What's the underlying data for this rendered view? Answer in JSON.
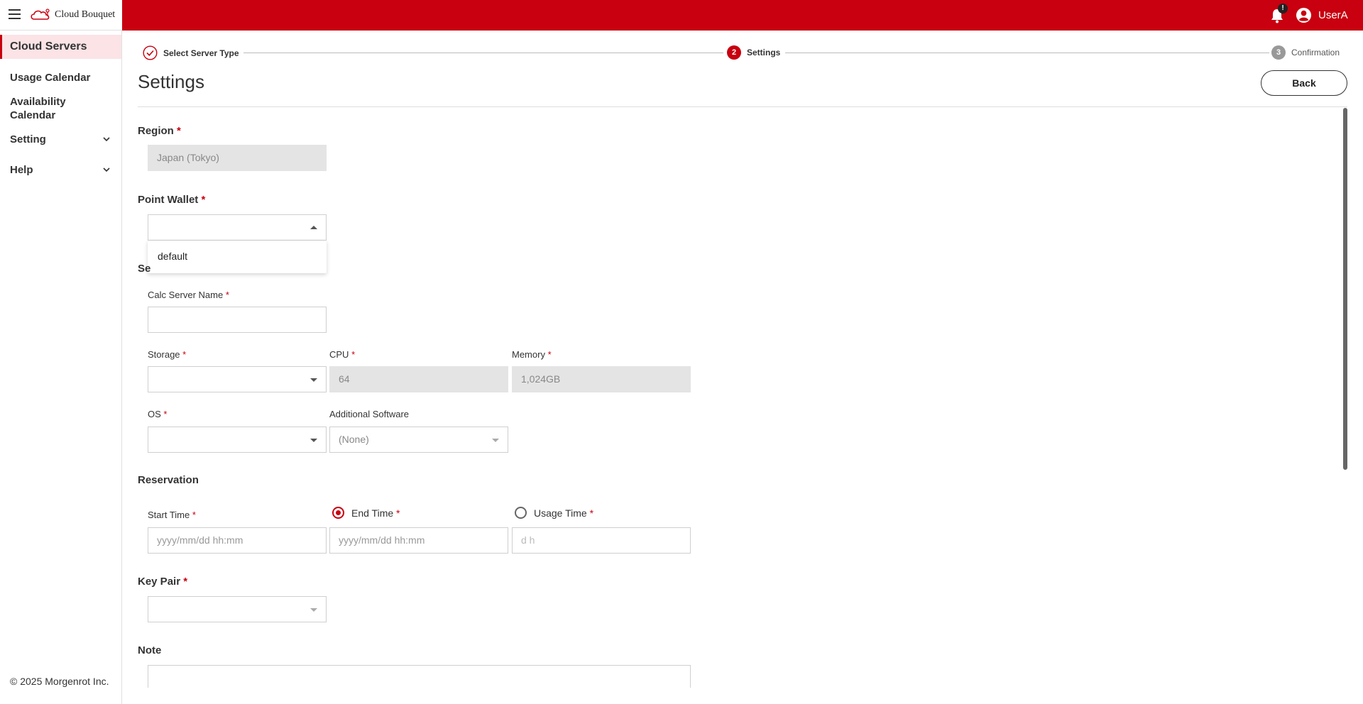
{
  "app": {
    "brand": "Cloud Bouquet",
    "user_name": "UserA",
    "notification_badge": "!"
  },
  "sidebar": {
    "items": [
      {
        "label": "Cloud Servers"
      },
      {
        "label": "Usage Calendar"
      },
      {
        "label": "Availability Calendar"
      },
      {
        "label": "Setting"
      },
      {
        "label": "Help"
      }
    ],
    "copyright": "© 2025 Morgenrot Inc."
  },
  "stepper": {
    "steps": [
      {
        "number": "",
        "label": "Select Server Type",
        "state": "done"
      },
      {
        "number": "2",
        "label": "Settings",
        "state": "active"
      },
      {
        "number": "3",
        "label": "Confirmation",
        "state": "pending"
      }
    ]
  },
  "page": {
    "title": "Settings",
    "back_label": "Back"
  },
  "form": {
    "region": {
      "label": "Region",
      "value": "Japan (Tokyo)"
    },
    "point_wallet": {
      "label": "Point Wallet",
      "value": "",
      "options": [
        "default"
      ]
    },
    "server_section_partial": "Se",
    "calc_server_name": {
      "label": "Calc Server Name",
      "value": ""
    },
    "storage": {
      "label": "Storage",
      "value": ""
    },
    "cpu": {
      "label": "CPU",
      "value": "64"
    },
    "memory": {
      "label": "Memory",
      "value": "1,024GB"
    },
    "os": {
      "label": "OS",
      "value": ""
    },
    "additional_software": {
      "label": "Additional Software",
      "value": "(None)"
    },
    "reservation": {
      "label": "Reservation",
      "start_time": {
        "label": "Start Time",
        "placeholder": "yyyy/mm/dd hh:mm"
      },
      "end_time": {
        "label": "End Time",
        "placeholder": "yyyy/mm/dd hh:mm",
        "selected": true
      },
      "usage_time": {
        "label": "Usage Time",
        "placeholder": "d  h",
        "selected": false
      }
    },
    "key_pair": {
      "label": "Key Pair",
      "value": ""
    },
    "note": {
      "label": "Note",
      "value": ""
    }
  },
  "colors": {
    "brand_red": "#c8000f",
    "active_bg": "#fbe3e6"
  }
}
